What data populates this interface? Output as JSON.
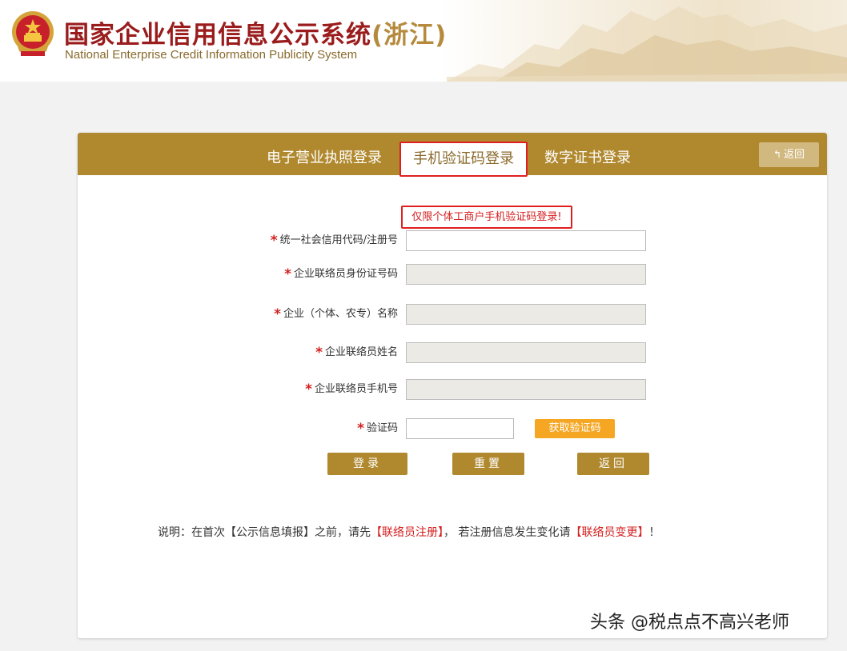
{
  "header": {
    "title": "国家企业信用信息公示系统",
    "region": "(浙江)",
    "subtitle": "National Enterprise Credit Information Publicity System"
  },
  "tabs": [
    {
      "label": "电子营业执照登录",
      "active": false
    },
    {
      "label": "手机验证码登录",
      "active": true
    },
    {
      "label": "数字证书登录",
      "active": false
    }
  ],
  "top_back_label": "返回",
  "notice": "仅限个体工商户手机验证码登录!",
  "form": {
    "required_mark": "*",
    "fields": [
      {
        "label": "统一社会信用代码/注册号",
        "value": "",
        "disabled": false
      },
      {
        "label": "企业联络员身份证号码",
        "value": "",
        "disabled": true
      },
      {
        "label": "企业（个体、农专）名称",
        "value": "",
        "disabled": true
      },
      {
        "label": "企业联络员姓名",
        "value": "",
        "disabled": true
      },
      {
        "label": "企业联络员手机号",
        "value": "",
        "disabled": true
      },
      {
        "label": "验证码",
        "value": "",
        "disabled": false
      }
    ],
    "get_code_label": "获取验证码"
  },
  "buttons": {
    "login": "登录",
    "reset": "重置",
    "back": "返回"
  },
  "note": {
    "prefix": "说明：在首次【公示信息填报】之前，请先",
    "link1": "【联络员注册】",
    "middle": "，  若注册信息发生变化请",
    "link2": "【联络员变更】",
    "suffix": "！"
  },
  "watermark": "头条 @税点点不高兴老师",
  "colors": {
    "accent_gold": "#b0892f",
    "title_red": "#9a1c1c",
    "required_red": "#d42020",
    "get_code_orange": "#f5a623"
  }
}
